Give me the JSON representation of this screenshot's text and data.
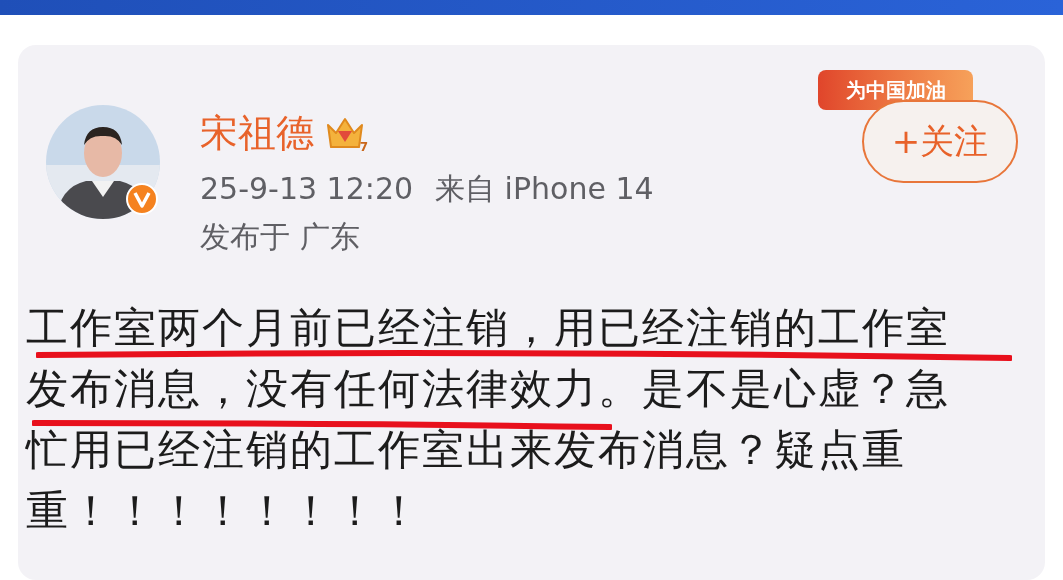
{
  "post": {
    "author": "宋祖德",
    "verified": true,
    "crown_level": "7",
    "time": "25-9-13 12:20",
    "source": "来自 iPhone 14",
    "location": "发布于 广东",
    "badge": "为中国加油",
    "follow_button": "+关注",
    "text_lines": [
      "工作室两个月前已经注销，用已经注销的工作室",
      "发布消息，没有任何法律效力。是不是心虚？急",
      "忙用已经注销的工作室出来发布消息？疑点重",
      "重！！！！！！！！"
    ]
  }
}
